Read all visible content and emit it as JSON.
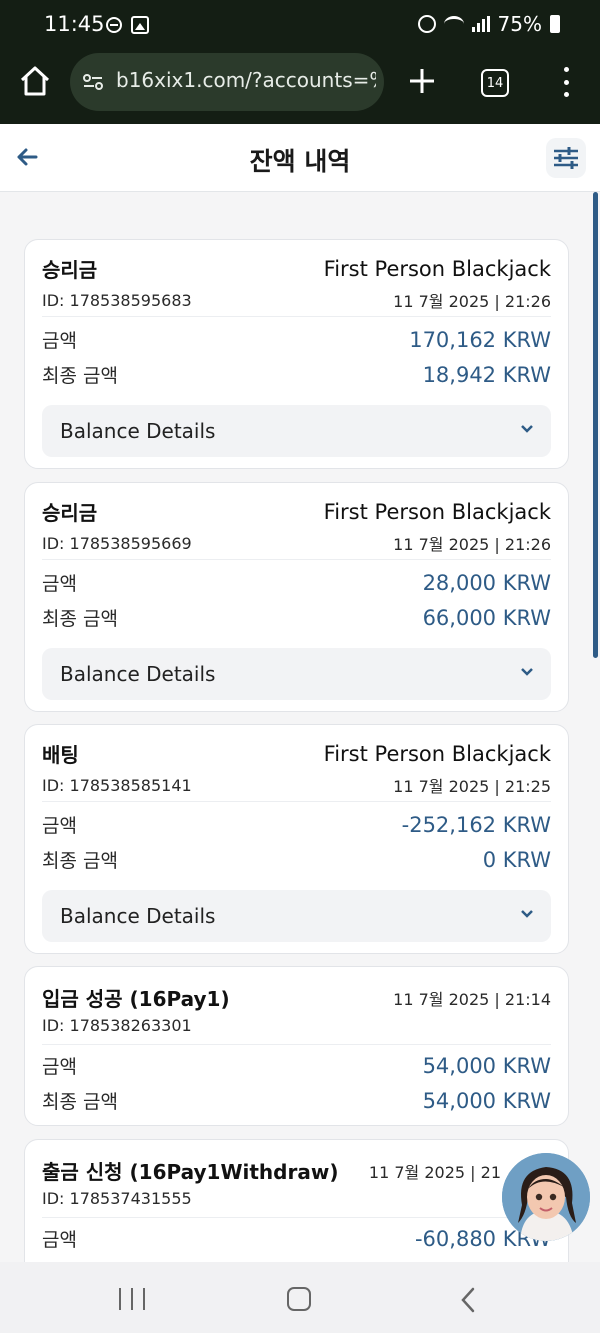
{
  "status_bar": {
    "time": "11:45",
    "battery": "75%"
  },
  "browser": {
    "url": "b16xix1.com/?accounts=%2",
    "tab_count": "14"
  },
  "header": {
    "title": "잔액 내역"
  },
  "transactions": [
    {
      "type": "승리금",
      "game": "First Person Blackjack",
      "id": "ID: 178538595683",
      "datetime": "11 7월 2025 | 21:26",
      "amount_label": "금액",
      "amount": "170,162 KRW",
      "final_label": "최종 금액",
      "final_amount": "18,942 KRW",
      "details_label": "Balance Details"
    },
    {
      "type": "승리금",
      "game": "First Person Blackjack",
      "id": "ID: 178538595669",
      "datetime": "11 7월 2025 | 21:26",
      "amount_label": "금액",
      "amount": "28,000 KRW",
      "final_label": "최종 금액",
      "final_amount": "66,000 KRW",
      "details_label": "Balance Details"
    },
    {
      "type": "배팅",
      "game": "First Person Blackjack",
      "id": "ID: 178538585141",
      "datetime": "11 7월 2025 | 21:25",
      "amount_label": "금액",
      "amount": "-252,162 KRW",
      "final_label": "최종 금액",
      "final_amount": "0 KRW",
      "details_label": "Balance Details"
    },
    {
      "type": "입금 성공 (16Pay1)",
      "id": "ID: 178538263301",
      "datetime": "11 7월 2025 | 21:14",
      "amount_label": "금액",
      "amount": "54,000 KRW",
      "final_label": "최종 금액",
      "final_amount": "54,000 KRW"
    },
    {
      "type": "출금 신청 (16Pay1Withdraw)",
      "id": "ID: 178537431555",
      "datetime": "11 7월 2025 | 21",
      "amount_label": "금액",
      "amount": "-60,880 KRW"
    }
  ],
  "colors": {
    "accent": "#2e5b86",
    "chrome": "#141e14"
  }
}
